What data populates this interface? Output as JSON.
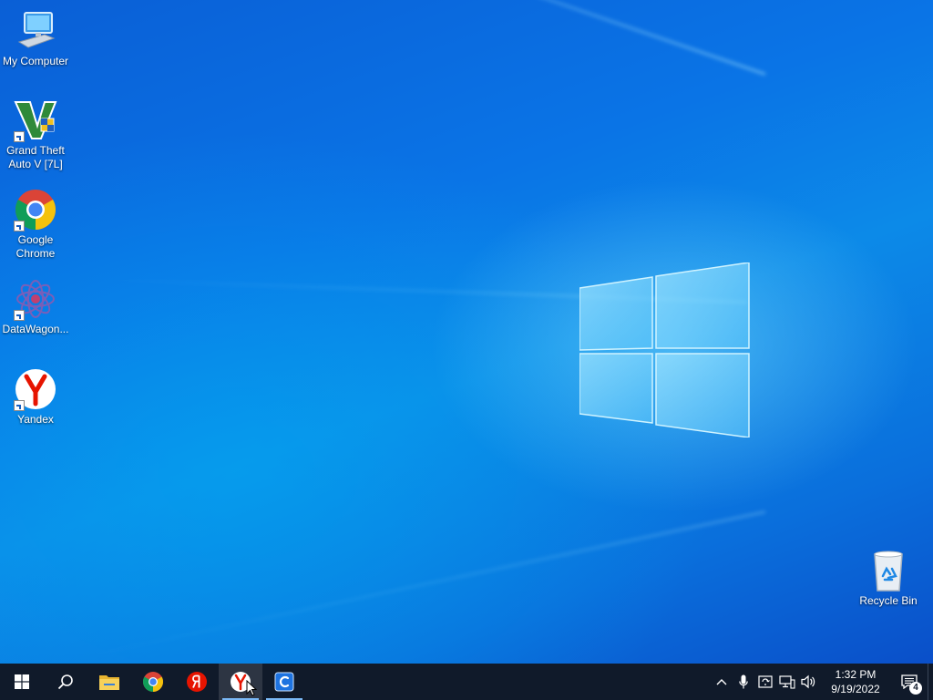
{
  "desktop": {
    "icons": [
      {
        "label": "My Computer",
        "icon": "computer-icon"
      },
      {
        "label": "Grand Theft Auto V [7L]",
        "icon": "gta-v-icon"
      },
      {
        "label": "Google Chrome",
        "icon": "chrome-icon"
      },
      {
        "label": "DataWagon...",
        "icon": "datawagon-icon"
      },
      {
        "label": "Yandex",
        "icon": "yandex-icon"
      },
      {
        "label": "Recycle Bin",
        "icon": "recycle-bin-icon"
      }
    ]
  },
  "taskbar": {
    "pinned": [
      {
        "icon": "windows-start-icon"
      },
      {
        "icon": "search-icon"
      },
      {
        "icon": "file-explorer-icon"
      },
      {
        "icon": "chrome-icon"
      },
      {
        "icon": "yandex-browser-icon"
      },
      {
        "icon": "yandex-icon",
        "active": true
      },
      {
        "icon": "app-c-icon"
      }
    ],
    "tray": {
      "icons": [
        "chevron-up-icon",
        "microphone-icon",
        "update-icon",
        "network-icon",
        "volume-icon"
      ],
      "time": "1:32 PM",
      "date": "9/19/2022",
      "notification_count": "4"
    }
  },
  "colors": {
    "taskbar_bg": "#101a2a",
    "accent": "#7ab8f5",
    "yandex_red": "#e61400"
  }
}
